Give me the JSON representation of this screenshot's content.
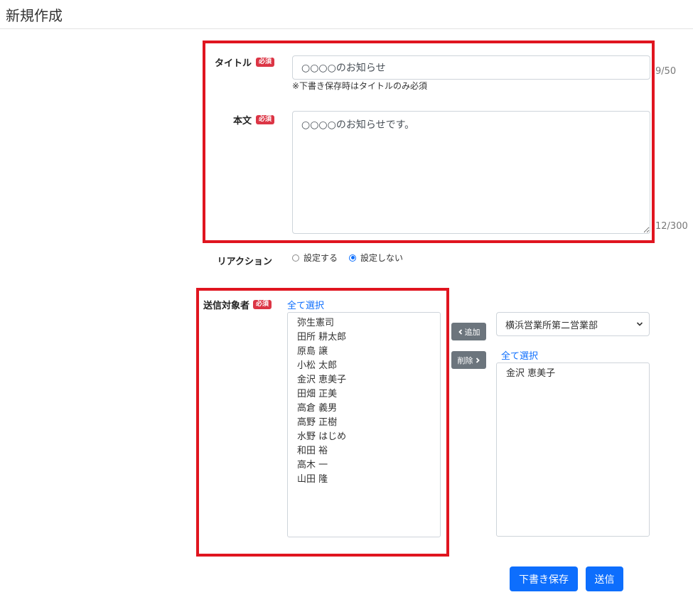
{
  "page": {
    "title": "新規作成"
  },
  "form": {
    "title_field": {
      "label": "タイトル",
      "required_badge": "必須",
      "value": "○○○○のお知らせ",
      "counter": "9/50",
      "hint": "※下書き保存時はタイトルのみ必須"
    },
    "body_field": {
      "label": "本文",
      "required_badge": "必須",
      "value": "○○○○のお知らせです。",
      "counter": "12/300"
    },
    "reaction": {
      "label": "リアクション",
      "options": [
        {
          "label": "設定する",
          "checked": false
        },
        {
          "label": "設定しない",
          "checked": true
        }
      ]
    },
    "recipients": {
      "label": "送信対象者",
      "required_badge": "必須",
      "select_all_left": "全て選択",
      "available": [
        "弥生憲司",
        "田所 耕太郎",
        "原島 譲",
        "小松 太郎",
        "金沢 恵美子",
        "田畑 正美",
        "高倉 義男",
        "高野 正樹",
        "水野 はじめ",
        "和田 裕",
        "高木 一",
        "山田 隆"
      ],
      "add_button": "追加",
      "remove_button": "削除",
      "department_select": "横浜営業所第二営業部",
      "select_all_right": "全て選択",
      "selected": [
        "金沢 恵美子"
      ]
    }
  },
  "actions": {
    "save_draft": "下書き保存",
    "send": "送信"
  },
  "colors": {
    "accent": "#0d6efd",
    "required_badge": "#dc3545",
    "highlight_border": "#e0151f",
    "secondary_button": "#6c757d"
  }
}
